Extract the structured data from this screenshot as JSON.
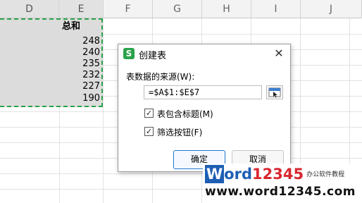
{
  "columns": [
    "D",
    "E",
    "F",
    "G",
    "H",
    "I",
    "J"
  ],
  "sheet": {
    "header_cell": "总和",
    "values": [
      "248",
      "240",
      "235",
      "232",
      "227",
      "190"
    ]
  },
  "dialog": {
    "title": "创建表",
    "logo_glyph": "S",
    "close_glyph": "✕",
    "source_label": "表数据的来源(W):",
    "range_value": "=$A$1:$E$7",
    "checkbox_header": {
      "label": "表包含标题(M)",
      "checked": true
    },
    "checkbox_filter": {
      "label": "筛选按钮(F)",
      "checked": true
    },
    "ok_label": "确定",
    "cancel_label": "取消"
  },
  "watermark": {
    "brand_letter": "W",
    "brand_rest": "ord",
    "brand_digits": "12345",
    "tagline": "办公软件教程",
    "url": "www.word12345.com"
  },
  "colors": {
    "selection_border": "#2aa24a",
    "accent_blue": "#1f78d1",
    "brand_blue": "#1e5fb4",
    "brand_red": "#d8262e"
  },
  "icons": {
    "dialog_logo": "wps-sheet-logo-icon",
    "close": "close-icon",
    "range_picker": "range-select-icon",
    "check": "checkmark-icon"
  }
}
